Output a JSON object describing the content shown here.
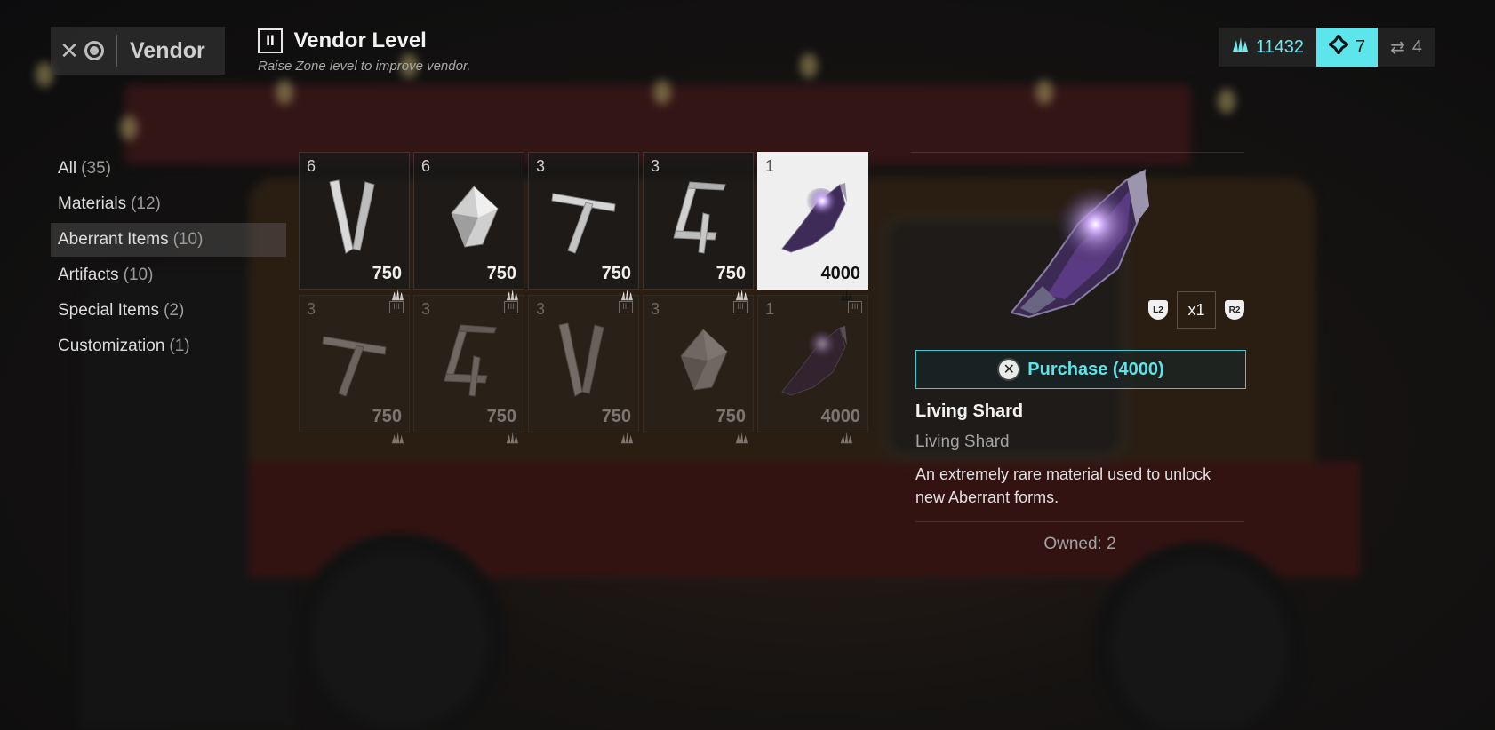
{
  "header": {
    "vendor_title": "Vendor",
    "level_roman": "II",
    "level_title": "Vendor Level",
    "level_subtitle": "Raise Zone level to improve vendor."
  },
  "currencies": [
    {
      "icon": "aberrant-currency-icon",
      "value": "11432",
      "color": "#6fe9ee"
    },
    {
      "icon": "vendor-token-icon",
      "value": "7",
      "highlighted": true
    },
    {
      "icon": "refresh-icon",
      "value": "4"
    }
  ],
  "categories": [
    {
      "label": "All",
      "count": "(35)",
      "active": false
    },
    {
      "label": "Materials",
      "count": "(12)",
      "active": false
    },
    {
      "label": "Aberrant Items",
      "count": "(10)",
      "active": true
    },
    {
      "label": "Artifacts",
      "count": "(10)",
      "active": false
    },
    {
      "label": "Special Items",
      "count": "(2)",
      "active": false
    },
    {
      "label": "Customization",
      "count": "(1)",
      "active": false
    }
  ],
  "items": [
    {
      "qty": "6",
      "price": "750",
      "icon": "v-fragment-icon",
      "tier": "",
      "selected": false,
      "locked": false
    },
    {
      "qty": "6",
      "price": "750",
      "icon": "crystal-shard-icon",
      "tier": "",
      "selected": false,
      "locked": false
    },
    {
      "qty": "3",
      "price": "750",
      "icon": "cross-fragment-icon",
      "tier": "",
      "selected": false,
      "locked": false
    },
    {
      "qty": "3",
      "price": "750",
      "icon": "bracket-fragment-icon",
      "tier": "",
      "selected": false,
      "locked": false
    },
    {
      "qty": "1",
      "price": "4000",
      "icon": "living-shard-icon",
      "tier": "",
      "selected": true,
      "locked": false
    },
    {
      "qty": "3",
      "price": "750",
      "icon": "cross-fragment-icon",
      "tier": "III",
      "selected": false,
      "locked": true
    },
    {
      "qty": "3",
      "price": "750",
      "icon": "bracket-fragment-icon",
      "tier": "III",
      "selected": false,
      "locked": true
    },
    {
      "qty": "3",
      "price": "750",
      "icon": "v-fragment-icon",
      "tier": "III",
      "selected": false,
      "locked": true
    },
    {
      "qty": "3",
      "price": "750",
      "icon": "crystal-shard-icon",
      "tier": "III",
      "selected": false,
      "locked": true
    },
    {
      "qty": "1",
      "price": "4000",
      "icon": "living-shard-icon",
      "tier": "III",
      "selected": false,
      "locked": true
    }
  ],
  "detail": {
    "quantity": "x1",
    "left_trigger": "L2",
    "right_trigger": "R2",
    "purchase_label": "Purchase (4000)",
    "name": "Living Shard",
    "type": "Living Shard",
    "description": "An extremely rare material used to unlock new Aberrant forms.",
    "owned": "Owned: 2"
  },
  "colors": {
    "accent": "#5ce6ec",
    "selected_card": "#efefef"
  }
}
